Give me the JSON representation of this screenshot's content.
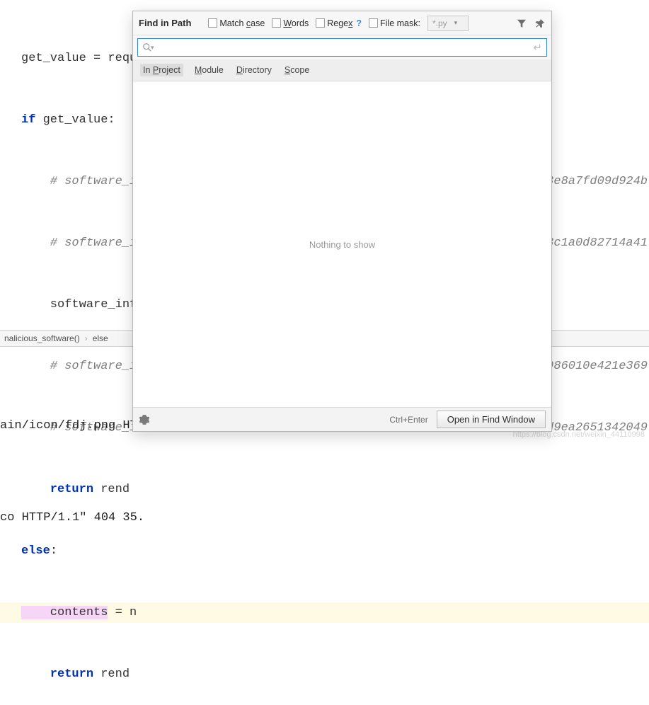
{
  "editor": {
    "lines": [
      {
        "plain": "get_value = requ",
        "kw": "",
        "after": ""
      },
      {
        "kw": "if",
        "plain": " get_value:"
      },
      {
        "cmt": "    # software_i",
        "trail": "3e8a7fd09d924b"
      },
      {
        "cmt": "    # software_i",
        "trail": "3c1a0d82714a41"
      },
      {
        "plain": "    software_inf"
      },
      {
        "cmt": "    # software_i",
        "trail": "986010e421e369"
      },
      {
        "cmt": "    # software_i",
        "trail": "d9ea2651342049"
      },
      {
        "kw": "    return",
        "plain": " rend"
      },
      {
        "kw_else": "else",
        "plain": ":"
      },
      {
        "sel": "    contents",
        "plain": " = n",
        "hl": true
      },
      {
        "kw": "    return",
        "plain": " rend"
      }
    ]
  },
  "breadcrumb": {
    "item1": "nalicious_software()",
    "item2": "else"
  },
  "runlog": {
    "line1": "ain/icon/fdj.png HTT",
    "line2": "co HTTP/1.1\" 404 35."
  },
  "dialog": {
    "title": "Find in Path",
    "options": {
      "match_case": {
        "label_pre": "Match ",
        "u": "c",
        "label_post": "ase"
      },
      "words": {
        "u": "W",
        "label_post": "ords"
      },
      "regex": {
        "label_pre": "Rege",
        "u": "x"
      },
      "filemask": {
        "label": "File mask:",
        "value": "*.py"
      }
    },
    "search": {
      "placeholder": ""
    },
    "tabs": {
      "project_pre": "In ",
      "project_u": "P",
      "project_post": "roject",
      "module_u": "M",
      "module_post": "odule",
      "directory_u": "D",
      "directory_post": "irectory",
      "scope_u": "S",
      "scope_post": "cope"
    },
    "results_empty": "Nothing to show",
    "footer": {
      "shortcut": "Ctrl+Enter",
      "open_btn": "Open in Find Window"
    }
  },
  "watermark": "https://blog.csdn.net/weixin_44110998"
}
